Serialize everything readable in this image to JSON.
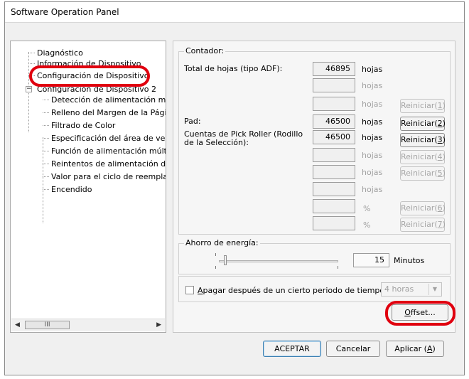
{
  "window": {
    "title": "Software Operation Panel"
  },
  "tree": {
    "items": [
      {
        "label": "Diagnóstico"
      },
      {
        "label": "Información de Dispositivo"
      },
      {
        "label": "Configuración de Dispositivo"
      },
      {
        "label": "Configuración de Dispositivo 2"
      },
      {
        "label": "Detección de alimentación mú"
      },
      {
        "label": "Relleno del Margen de la Pági"
      },
      {
        "label": "Filtrado de Color"
      },
      {
        "label": "Especificación del área de ver"
      },
      {
        "label": "Función de alimentación múltip"
      },
      {
        "label": "Reintentos de alimentación de"
      },
      {
        "label": "Valor para el ciclo de reemplaz"
      },
      {
        "label": "Encendido"
      }
    ],
    "expander": "−",
    "scroll_thumb": "III"
  },
  "counter": {
    "group_label": "Contador:",
    "rows": [
      {
        "label": "Total de hojas (tipo ADF):",
        "value": "46895",
        "unit": "hojas",
        "button": ""
      },
      {
        "label": "",
        "value": "",
        "unit": "hojas",
        "button": ""
      },
      {
        "label": "",
        "value": "",
        "unit": "hojas",
        "button_text": "Reiniciar(",
        "button_key": "1",
        "button_end": ")"
      },
      {
        "label": "Pad:",
        "value": "46500",
        "unit": "hojas",
        "button_text": "Reiniciar(",
        "button_key": "2",
        "button_end": ")"
      },
      {
        "label": "Cuentas de Pick Roller (Rodillo de la  Selección):",
        "value": "46500",
        "unit": "hojas",
        "button_text": "Reiniciar(",
        "button_key": "3",
        "button_end": ")"
      },
      {
        "label": "",
        "value": "",
        "unit": "hojas",
        "button_text": "Reiniciar(",
        "button_key": "4",
        "button_end": ")"
      },
      {
        "label": "",
        "value": "",
        "unit": "hojas",
        "button_text": "Reiniciar(",
        "button_key": "5",
        "button_end": ")"
      },
      {
        "label": "",
        "value": "",
        "unit": "hojas",
        "button": ""
      },
      {
        "label": "",
        "value": "",
        "unit": "%",
        "button_text": "Reiniciar(",
        "button_key": "6",
        "button_end": ")"
      },
      {
        "label": "",
        "value": "",
        "unit": "%",
        "button_text": "Reiniciar(",
        "button_key": "7",
        "button_end": ")"
      }
    ]
  },
  "energy": {
    "group_label": "Ahorro de energía:",
    "value": "15",
    "unit": "Minutos",
    "slider_level": 0.05,
    "checkbox_label_key": "A",
    "checkbox_label_rest": "pagar después de un cierto periodo de tiempo",
    "checkbox_checked": false,
    "select_value": "4 horas"
  },
  "buttons": {
    "offset_key": "O",
    "offset_rest": "ffset...",
    "accept": "ACEPTAR",
    "cancel": "Cancelar",
    "apply_text": "Aplicar (",
    "apply_key": "A",
    "apply_end": ")"
  },
  "colors": {
    "highlight": "#e0000f",
    "disabled_text": "#a0a0a0"
  }
}
